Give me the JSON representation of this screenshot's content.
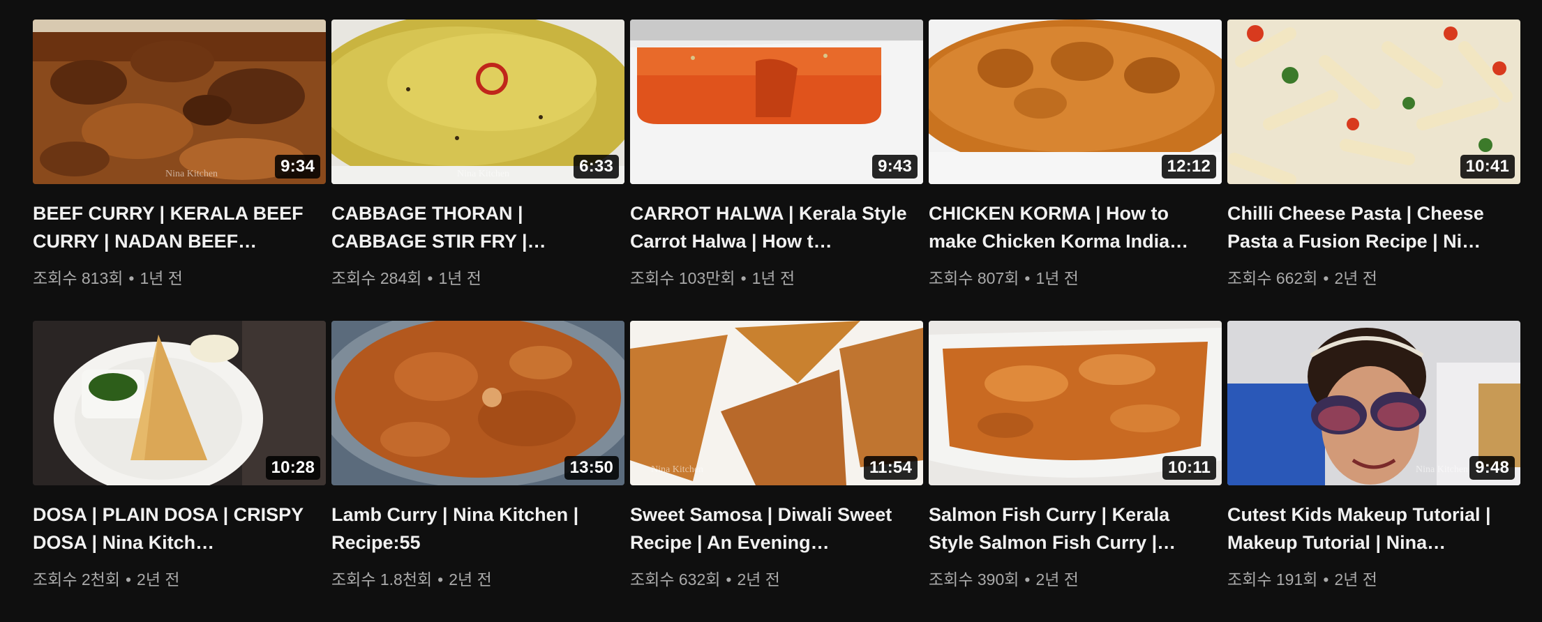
{
  "videos": [
    {
      "title": "BEEF CURRY | KERALA BEEF CURRY | NADAN BEEF…",
      "duration": "9:34",
      "views": "조회수 813회",
      "age": "1년 전",
      "thumb": "beef-curry"
    },
    {
      "title": "CABBAGE THORAN | CABBAGE STIR FRY |…",
      "duration": "6:33",
      "views": "조회수 284회",
      "age": "1년 전",
      "thumb": "cabbage-thoran"
    },
    {
      "title": "CARROT HALWA | Kerala Style Carrot Halwa | How t…",
      "duration": "9:43",
      "views": "조회수 103만회",
      "age": "1년 전",
      "thumb": "carrot-halwa"
    },
    {
      "title": "CHICKEN KORMA | How to make Chicken Korma India…",
      "duration": "12:12",
      "views": "조회수 807회",
      "age": "1년 전",
      "thumb": "chicken-korma"
    },
    {
      "title": "Chilli Cheese Pasta | Cheese Pasta a Fusion Recipe | Ni…",
      "duration": "10:41",
      "views": "조회수 662회",
      "age": "2년 전",
      "thumb": "cheese-pasta"
    },
    {
      "title": "DOSA | PLAIN DOSA | CRISPY DOSA | Nina Kitch…",
      "duration": "10:28",
      "views": "조회수 2천회",
      "age": "2년 전",
      "thumb": "dosa"
    },
    {
      "title": "Lamb Curry | Nina Kitchen | Recipe:55",
      "duration": "13:50",
      "views": "조회수 1.8천회",
      "age": "2년 전",
      "thumb": "lamb-curry"
    },
    {
      "title": "Sweet Samosa | Diwali Sweet Recipe | An Evening…",
      "duration": "11:54",
      "views": "조회수 632회",
      "age": "2년 전",
      "thumb": "sweet-samosa"
    },
    {
      "title": "Salmon Fish Curry | Kerala Style Salmon Fish Curry |…",
      "duration": "10:11",
      "views": "조회수 390회",
      "age": "2년 전",
      "thumb": "salmon-curry"
    },
    {
      "title": "Cutest Kids Makeup Tutorial | Makeup Tutorial | Nina…",
      "duration": "9:48",
      "views": "조회수 191회",
      "age": "2년 전",
      "thumb": "kids-makeup"
    }
  ],
  "separator": "•",
  "watermark": "Nina Kitchen"
}
